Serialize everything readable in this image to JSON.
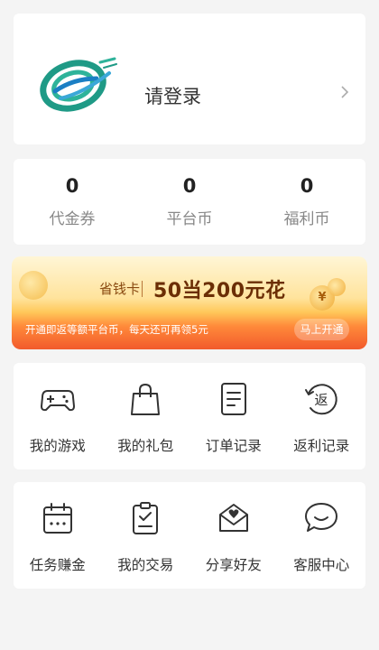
{
  "login": {
    "label": "请登录"
  },
  "stats": [
    {
      "value": "0",
      "label": "代金券"
    },
    {
      "value": "0",
      "label": "平台币"
    },
    {
      "value": "0",
      "label": "福利币"
    }
  ],
  "promo": {
    "card_name": "省钱卡",
    "headline": "50当200元花",
    "subtitle": "开通即返等额平台币，每天还可再领5元",
    "button": "马上开通",
    "coin_symbol": "¥"
  },
  "menu_row1": [
    {
      "label": "我的游戏",
      "icon": "gamepad-icon"
    },
    {
      "label": "我的礼包",
      "icon": "gift-bag-icon"
    },
    {
      "label": "订单记录",
      "icon": "order-list-icon"
    },
    {
      "label": "返利记录",
      "icon": "rebate-icon",
      "glyph": "返"
    }
  ],
  "menu_row2": [
    {
      "label": "任务赚金",
      "icon": "calendar-task-icon"
    },
    {
      "label": "我的交易",
      "icon": "clipboard-check-icon"
    },
    {
      "label": "分享好友",
      "icon": "share-envelope-icon"
    },
    {
      "label": "客服中心",
      "icon": "chat-bubble-icon"
    }
  ]
}
